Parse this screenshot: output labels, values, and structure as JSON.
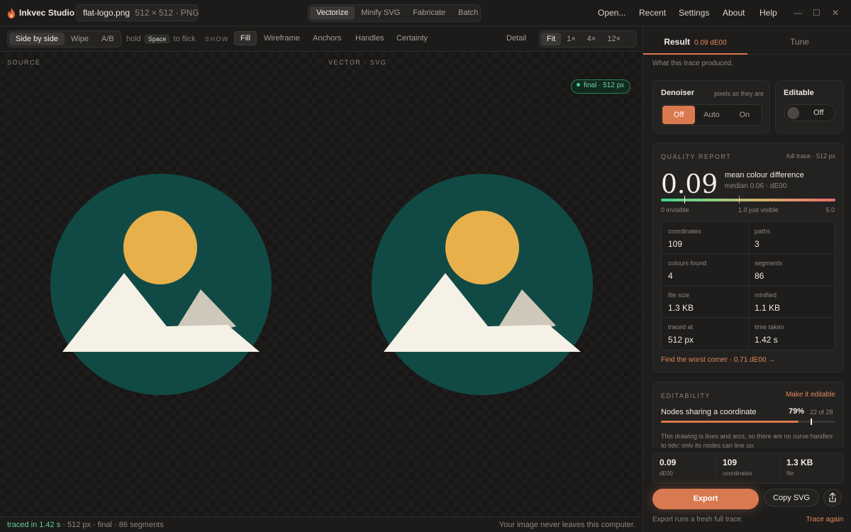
{
  "app": {
    "name": "Inkvec Studio"
  },
  "file": {
    "name": "flat-logo.png",
    "meta": "512 × 512 · PNG"
  },
  "mode_tabs": [
    {
      "label": "Vectorize",
      "active": true
    },
    {
      "label": "Minify SVG",
      "active": false
    },
    {
      "label": "Fabricate",
      "active": false
    },
    {
      "label": "Batch",
      "active": false
    }
  ],
  "menu": [
    "Open...",
    "Recent",
    "Settings",
    "About",
    "Help"
  ],
  "window_controls": {
    "minimize": "—",
    "maximize": "☐",
    "close": "✕"
  },
  "toolbar": {
    "view_modes": [
      {
        "label": "Side by side",
        "active": true
      },
      {
        "label": "Wipe",
        "active": false
      },
      {
        "label": "A/B",
        "active": false
      }
    ],
    "hint_prefix": "hold",
    "hint_key": "Space",
    "hint_suffix": "to flick",
    "show_label": "SHOW",
    "show_options": [
      {
        "label": "Fill",
        "active": true
      },
      {
        "label": "Wireframe",
        "active": false
      },
      {
        "label": "Anchors",
        "active": false
      },
      {
        "label": "Handles",
        "active": false
      },
      {
        "label": "Certainty",
        "active": false
      }
    ],
    "detail_label": "Detail",
    "zoom_options": [
      {
        "label": "Fit",
        "active": true
      },
      {
        "label": "1×",
        "active": false
      },
      {
        "label": "4×",
        "active": false
      },
      {
        "label": "12×",
        "active": false
      }
    ]
  },
  "canvas": {
    "source_label": "SOURCE",
    "vector_label": "VECTOR · SVG",
    "final_badge": "final · 512 px",
    "colors": {
      "circle": "#114a45",
      "sun": "#e8b04a",
      "mountain": "#f5f1e6",
      "peak": "#cfc8ba"
    }
  },
  "status": {
    "traced": "traced in 1.42 s",
    "info": "· 512 px · final · 86 segments",
    "privacy": "Your image never leaves this computer."
  },
  "panel": {
    "tab_result": "Result",
    "tab_result_sub": "0.09 dE00",
    "tab_tune": "Tune",
    "subtitle": "What this trace produced.",
    "denoiser": {
      "title": "Denoiser",
      "note": "pixels as they are",
      "options": [
        {
          "label": "Off",
          "active": true
        },
        {
          "label": "Auto",
          "active": false
        },
        {
          "label": "On",
          "active": false
        }
      ]
    },
    "editable": {
      "title": "Editable",
      "state": "Off"
    },
    "quality": {
      "label": "QUALITY REPORT",
      "scope": "full trace · 512 px",
      "value": "0.09",
      "metric_name": "mean colour difference",
      "metric_sub": "median 0.06 · dE00",
      "scale_min": "0 invisible",
      "scale_mid": "1.0 just visible",
      "scale_max": "5.0",
      "stats": [
        {
          "key": "coordinates",
          "value": "109"
        },
        {
          "key": "paths",
          "value": "3"
        },
        {
          "key": "colours found",
          "value": "4"
        },
        {
          "key": "segments",
          "value": "86"
        },
        {
          "key": "file size",
          "value": "1.3 KB"
        },
        {
          "key": "minified",
          "value": "1.1 KB"
        },
        {
          "key": "traced at",
          "value": "512 px"
        },
        {
          "key": "time taken",
          "value": "1.42 s"
        }
      ],
      "worst_link": "Find the worst corner · 0.71 dE00 →"
    },
    "editability": {
      "label": "EDITABILITY",
      "action": "Make it editable",
      "row_label": "Nodes sharing a coordinate",
      "percent": "79%",
      "percent_value": 0.79,
      "of": "22 of 28",
      "desc": "This drawing is lines and arcs, so there are no curve handles to tidy; only its nodes can line up."
    },
    "summary": [
      {
        "value": "0.09",
        "key": "dE00"
      },
      {
        "value": "109",
        "key": "coordinates"
      },
      {
        "value": "1.3 KB",
        "key": "file"
      }
    ],
    "export_label": "Export",
    "copy_label": "Copy SVG",
    "export_note": "Export runs a fresh full trace.",
    "trace_again": "Trace again"
  }
}
